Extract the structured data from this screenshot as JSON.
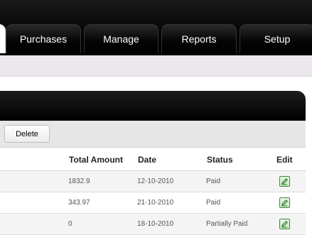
{
  "nav": {
    "tabs": [
      {
        "label": ""
      },
      {
        "label": "Purchases"
      },
      {
        "label": "Manage"
      },
      {
        "label": "Reports"
      },
      {
        "label": "Setup"
      }
    ]
  },
  "toolbar": {
    "delete_label": "Delete"
  },
  "table": {
    "columns": {
      "total_amount": "Total Amount",
      "date": "Date",
      "status": "Status",
      "edit": "Edit"
    },
    "rows": [
      {
        "total_amount": "1832.9",
        "date": "12-10-2010",
        "status": "Paid",
        "edit_icon": "edit-pencil-icon"
      },
      {
        "total_amount": "343.97",
        "date": "21-10-2010",
        "status": "Paid",
        "edit_icon": "edit-pencil-icon"
      },
      {
        "total_amount": "0",
        "date": "18-10-2010",
        "status": "Partially Paid",
        "edit_icon": "edit-pencil-icon"
      }
    ]
  },
  "colors": {
    "header_dark": "#000000",
    "subbar": "#ece7ec",
    "toolbar": "#e6e6e6",
    "edit_icon": "#3a8a3a"
  }
}
